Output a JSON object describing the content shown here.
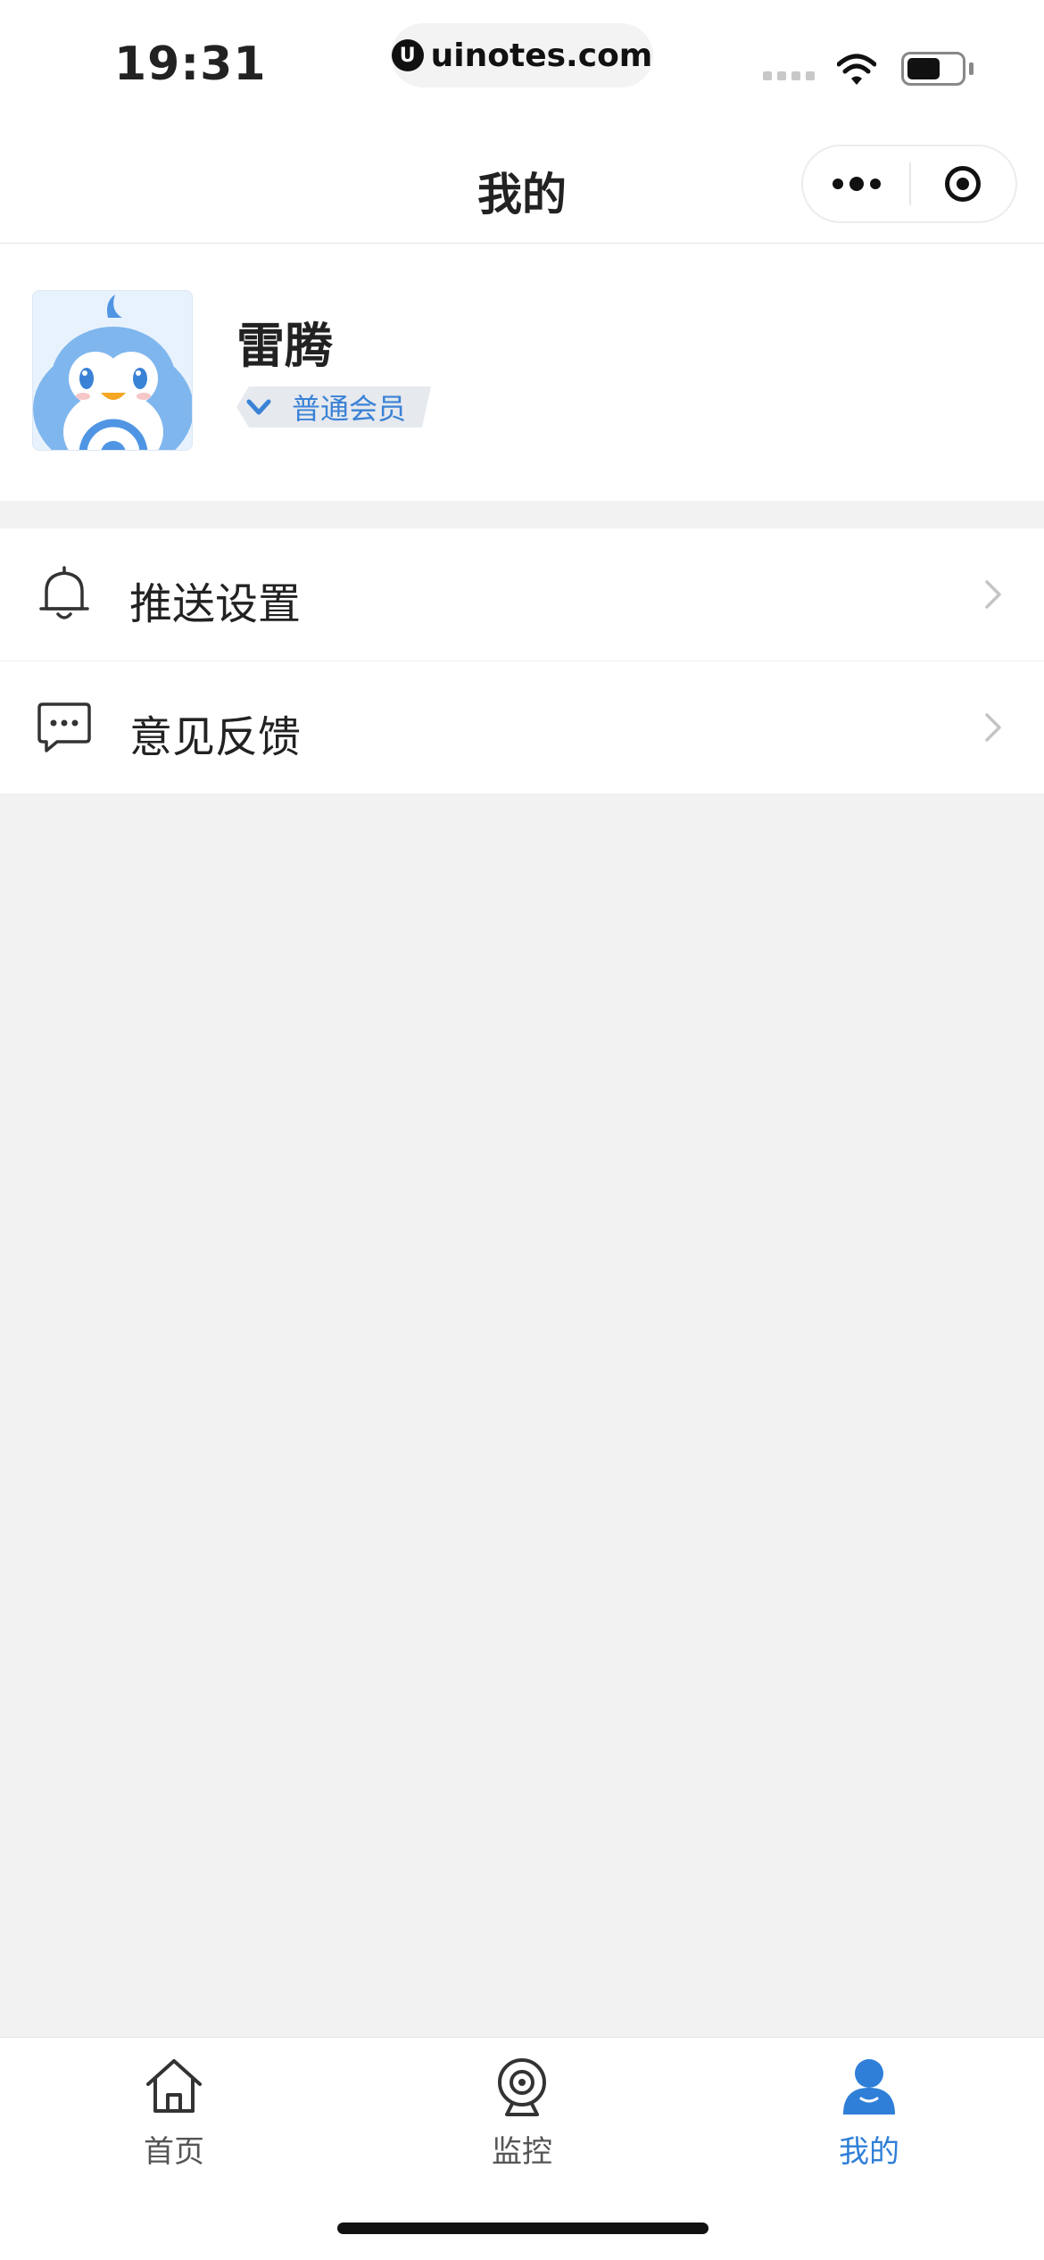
{
  "status_bar": {
    "time": "19:31",
    "url": "uinotes.com"
  },
  "nav": {
    "title": "我的"
  },
  "profile": {
    "username": "雷腾",
    "member_level": "普通会员"
  },
  "menu": {
    "items": [
      {
        "label": "推送设置",
        "icon": "bell-icon"
      },
      {
        "label": "意见反馈",
        "icon": "chat-bubble-icon"
      }
    ]
  },
  "tabbar": {
    "items": [
      {
        "label": "首页",
        "icon": "home-icon",
        "active": false
      },
      {
        "label": "监控",
        "icon": "webcam-icon",
        "active": false
      },
      {
        "label": "我的",
        "icon": "person-icon",
        "active": true
      }
    ]
  },
  "colors": {
    "accent": "#2f7fd8",
    "background": "#f2f2f2",
    "surface": "#ffffff"
  }
}
